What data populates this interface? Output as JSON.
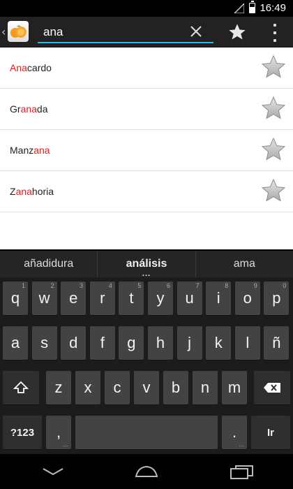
{
  "status": {
    "time": "16:49"
  },
  "search": {
    "query": "ana"
  },
  "results": [
    {
      "pre": "",
      "match": "Ana",
      "post": "cardo"
    },
    {
      "pre": "Gr",
      "match": "ana",
      "post": "da"
    },
    {
      "pre": "Manz",
      "match": "ana",
      "post": ""
    },
    {
      "pre": "Z",
      "match": "ana",
      "post": "horia"
    }
  ],
  "suggestions": [
    "añadidura",
    "análisis",
    "ama"
  ],
  "keyboard": {
    "row1": [
      {
        "k": "q",
        "h": "1"
      },
      {
        "k": "w",
        "h": "2"
      },
      {
        "k": "e",
        "h": "3"
      },
      {
        "k": "r",
        "h": "4"
      },
      {
        "k": "t",
        "h": "5"
      },
      {
        "k": "y",
        "h": "6"
      },
      {
        "k": "u",
        "h": "7"
      },
      {
        "k": "i",
        "h": "8"
      },
      {
        "k": "o",
        "h": "9"
      },
      {
        "k": "p",
        "h": "0"
      }
    ],
    "row2": [
      "a",
      "s",
      "d",
      "f",
      "g",
      "h",
      "j",
      "k",
      "l",
      "ñ"
    ],
    "row3": [
      "z",
      "x",
      "c",
      "v",
      "b",
      "n",
      "m"
    ],
    "symbols_label": "?123",
    "comma": ",",
    "period": ".",
    "lang_label": "Ir"
  },
  "colors": {
    "accent": "#33b5e5",
    "highlight": "#e31b1b"
  }
}
